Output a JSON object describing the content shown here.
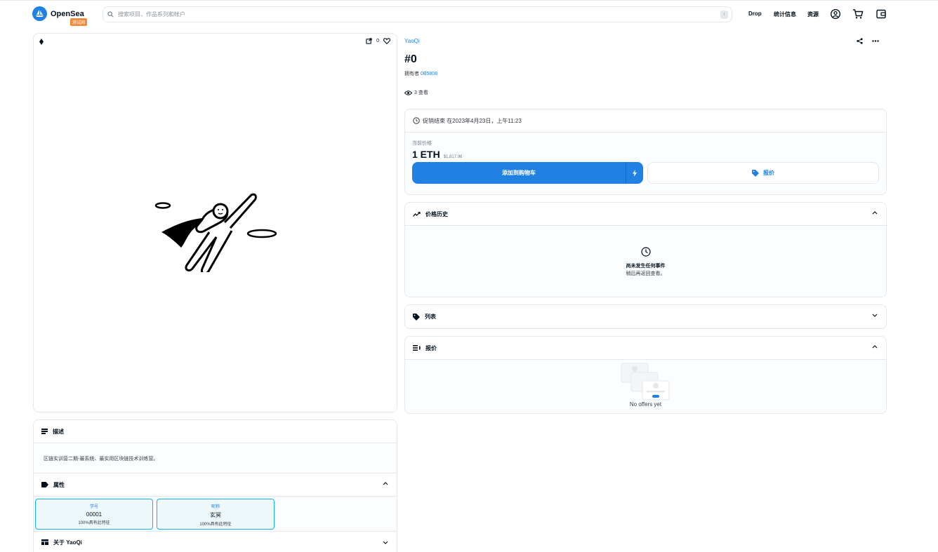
{
  "header": {
    "logo_text": "OpenSea",
    "testnet_badge": "测试网",
    "search_placeholder": "搜索项目、作品系列和帐户",
    "search_shortcut": "/",
    "nav": {
      "drop": "Drop",
      "stats": "统计信息",
      "resources": "资源"
    }
  },
  "media": {
    "favorite_count": "0"
  },
  "description": {
    "title": "描述",
    "text": "区链实训营二期-最系统、最实用区块链技术训练营。"
  },
  "properties": {
    "title": "属性",
    "items": [
      {
        "type": "学号",
        "value": "00001",
        "rarity": "100%具有此特征"
      },
      {
        "type": "昵称",
        "value": "玄冥",
        "rarity": "100%具有此特征"
      }
    ]
  },
  "about": {
    "title": "关于 YaoQi"
  },
  "item": {
    "collection": "YaoQi",
    "title": "#0",
    "owner_label": "拥有者",
    "owner_address": "0B5808",
    "views": "3 查看"
  },
  "sale": {
    "ends_text": "促销结束 在2023年4月23日，上午11:23",
    "price_label": "当前价格",
    "price": "1 ETH",
    "price_usd": "$1,817.96",
    "add_to_cart": "添加到购物车",
    "make_offer": "报价"
  },
  "price_history": {
    "title": "价格历史",
    "empty_title": "尚未发生任何事件",
    "empty_sub": "稍后再返回查看。"
  },
  "listings": {
    "title": "列表"
  },
  "offers": {
    "title": "报价",
    "empty": "No offers yet"
  },
  "colors": {
    "accent": "#2081e2",
    "badge": "#f08b3d",
    "border": "#e5e8eb",
    "trait_border": "#15b2e5"
  }
}
